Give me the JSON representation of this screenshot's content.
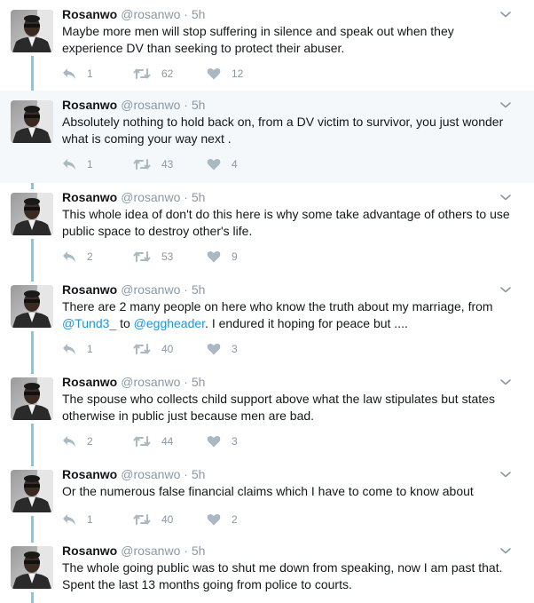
{
  "colors": {
    "name": "#14171a",
    "meta": "#8899a6",
    "link": "#1b95e0",
    "thread": "#7fc6ea",
    "highlight": "#f5f8fa"
  },
  "icons": {
    "reply": "reply-icon",
    "retweet": "retweet-icon",
    "like": "heart-icon",
    "menu": "chevron-down-icon"
  },
  "tweets": [
    {
      "name": "Rosanwo",
      "handle": "@rosanwo",
      "time": "5h",
      "segments": [
        {
          "t": "Maybe more men will stop suffering in silence and speak out when they experience DV than seeking to protect their abuser."
        }
      ],
      "replies": "1",
      "retweets": "62",
      "likes": "12"
    },
    {
      "name": "Rosanwo",
      "handle": "@rosanwo",
      "time": "5h",
      "segments": [
        {
          "t": "Absolutely nothing to hold back on, from a DV victim to survivor, you just wonder what is coming your way next ."
        }
      ],
      "replies": "1",
      "retweets": "43",
      "likes": "4"
    },
    {
      "name": "Rosanwo",
      "handle": "@rosanwo",
      "time": "5h",
      "segments": [
        {
          "t": "This whole idea of don't do this here is why some take advantage of others to use public space to destroy other's life."
        }
      ],
      "replies": "2",
      "retweets": "53",
      "likes": "9"
    },
    {
      "name": "Rosanwo",
      "handle": "@rosanwo",
      "time": "5h",
      "segments": [
        {
          "t": "There are 2 many people on here who know the truth about my marriage, from "
        },
        {
          "t": "@Tund3_",
          "link": true
        },
        {
          "t": " to "
        },
        {
          "t": "@eggheader",
          "link": true
        },
        {
          "t": ". I endured it hoping for peace but ...."
        }
      ],
      "replies": "1",
      "retweets": "40",
      "likes": "3"
    },
    {
      "name": "Rosanwo",
      "handle": "@rosanwo",
      "time": "5h",
      "segments": [
        {
          "t": "The spouse who collects child support above what the law stipulates but states otherwise in public just because men are bad."
        }
      ],
      "replies": "2",
      "retweets": "44",
      "likes": "3"
    },
    {
      "name": "Rosanwo",
      "handle": "@rosanwo",
      "time": "5h",
      "segments": [
        {
          "t": "Or the numerous false financial claims which I have to come to know about"
        }
      ],
      "replies": "1",
      "retweets": "40",
      "likes": "2"
    },
    {
      "name": "Rosanwo",
      "handle": "@rosanwo",
      "time": "5h",
      "segments": [
        {
          "t": "The whole going public was to shut me down from speaking, now I am past that. Spent the last 13 months going from police to courts."
        }
      ],
      "replies": "",
      "retweets": "",
      "likes": ""
    }
  ]
}
